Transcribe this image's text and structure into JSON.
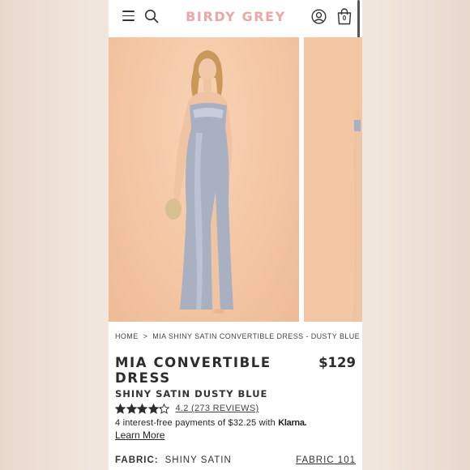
{
  "header": {
    "brand": "BIRDY GREY",
    "bag_count": "0",
    "brand_color": "#e8a8a5"
  },
  "gallery": {
    "background_color": "#f3c6a4",
    "dress_color": "#a9b0c2"
  },
  "breadcrumb": {
    "home": "HOME",
    "separator": ">",
    "current": "MIA SHINY SATIN CONVERTIBLE DRESS - DUSTY BLUE"
  },
  "product": {
    "title": "MIA CONVERTIBLE DRESS",
    "price": "$129",
    "subtitle": "SHINY SATIN DUSTY BLUE",
    "rating": 4.2,
    "reviews_text": "4.2 (273 REVIEWS)",
    "installments_text": "4 interest-free payments of $32.25 with",
    "klarna": "Klarna.",
    "learn_more": "Learn More",
    "fabric_label": "FABRIC:",
    "fabric_value": "SHINY SATIN",
    "fabric_link": "FABRIC 101"
  }
}
